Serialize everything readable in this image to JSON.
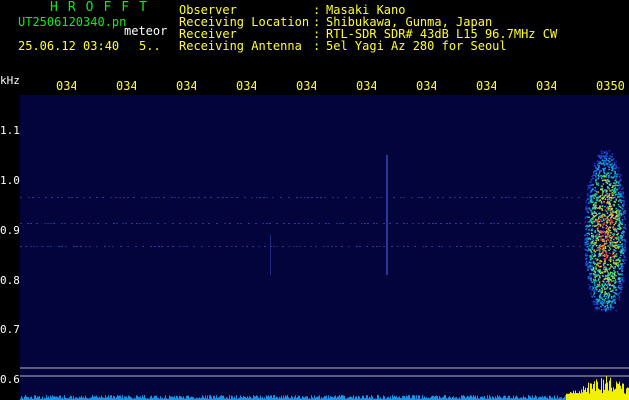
{
  "header": {
    "brand": "HROFFT",
    "filename": "UT2506120340.pn",
    "filetype": "meteor",
    "datetime": "25.06.12 03:40",
    "datetime_extra": "5..",
    "fields": [
      {
        "label": "Observer",
        "value": "Masaki Kano"
      },
      {
        "label": "Receiving Location",
        "value": "Shibukawa, Gunma, Japan"
      },
      {
        "label": "Receiver",
        "value": "RTL-SDR SDR# 43dB L15 96.7MHz CW"
      },
      {
        "label": "Receiving Antenna",
        "value": "5el Yagi Az 280 for Seoul"
      }
    ],
    "separator": ":"
  },
  "chart_data": {
    "type": "heatmap",
    "ylabel": "kHz",
    "yticks": [
      "1.1",
      "1.0",
      "0.9",
      "0.8",
      "0.7",
      "0.6"
    ],
    "xticks": [
      "034",
      "034",
      "034",
      "034",
      "034",
      "034",
      "034",
      "034",
      "034",
      "0350"
    ],
    "ylim": [
      0.58,
      1.2
    ],
    "echo": {
      "x_index_start": 8.7,
      "x_index_end": 9.2,
      "y_low": 0.73,
      "y_high": 0.98
    }
  },
  "colors": {
    "background": "#000000",
    "header_green": "#19e619",
    "tick_yellow": "#ffff30",
    "plot_bg": "#04043c"
  }
}
